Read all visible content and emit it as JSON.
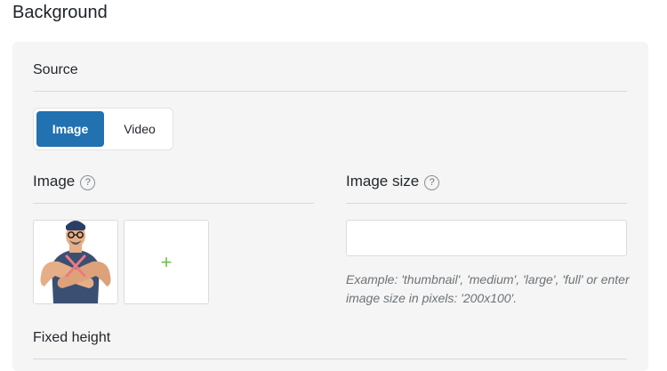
{
  "page": {
    "title": "Background"
  },
  "source": {
    "label": "Source",
    "tabs": [
      {
        "label": "Image",
        "active": true
      },
      {
        "label": "Video",
        "active": false
      }
    ]
  },
  "image": {
    "label": "Image",
    "help": "?",
    "add_label": "+"
  },
  "image_size": {
    "label": "Image size",
    "help": "?",
    "value": "",
    "hint": "Example: 'thumbnail', 'medium', 'large', 'full' or enter image size in pixels: '200x100'."
  },
  "fixed_height": {
    "label": "Fixed height"
  },
  "colors": {
    "accent": "#2271b1",
    "add": "#6bc24a",
    "panel": "#f5f5f5"
  }
}
